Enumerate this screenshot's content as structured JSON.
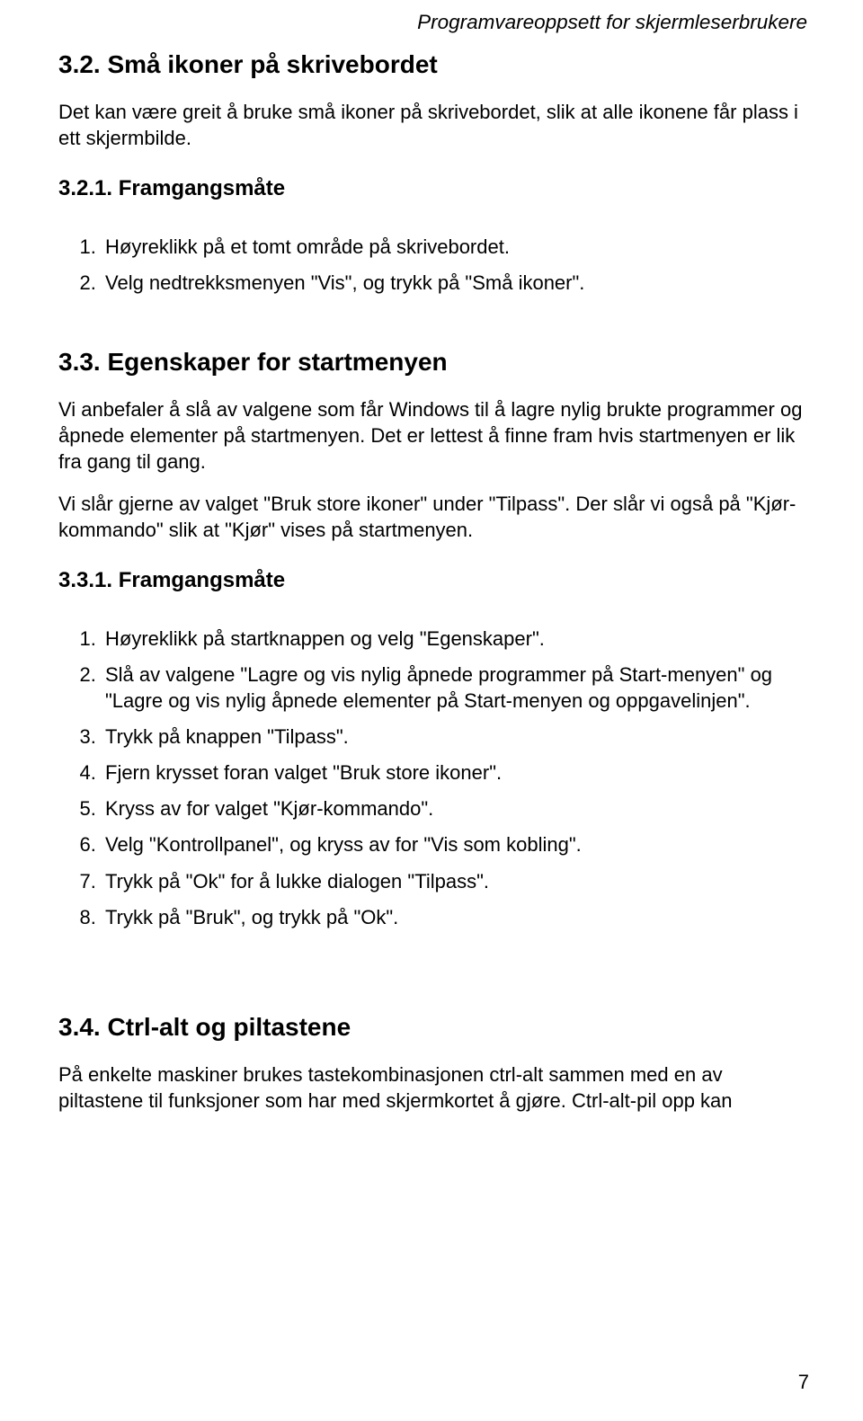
{
  "running_head": "Programvareoppsett for skjermleserbrukere",
  "sec32": {
    "title": "3.2. Små ikoner på skrivebordet",
    "p1": "Det kan være greit å bruke små ikoner på skrivebordet, slik at alle ikonene får plass i ett skjermbilde."
  },
  "sec321": {
    "title": "3.2.1. Framgangsmåte",
    "steps": [
      "Høyreklikk på et tomt område på skrivebordet.",
      "Velg nedtrekksmenyen \"Vis\", og trykk på \"Små ikoner\"."
    ]
  },
  "sec33": {
    "title": "3.3. Egenskaper for startmenyen",
    "p1": "Vi anbefaler å slå av valgene som får Windows til å lagre nylig brukte programmer og åpnede elementer på startmenyen. Det er lettest å finne fram hvis startmenyen er lik fra gang til gang.",
    "p2": "Vi slår gjerne av valget \"Bruk store ikoner\" under \"Tilpass\". Der slår vi også på \"Kjør-kommando\" slik at \"Kjør\" vises på startmenyen."
  },
  "sec331": {
    "title": "3.3.1. Framgangsmåte",
    "steps": [
      "Høyreklikk på startknappen og velg \"Egenskaper\".",
      "Slå av valgene \"Lagre og vis nylig åpnede programmer på Start-menyen\" og \"Lagre og vis nylig åpnede elementer på Start-menyen og oppgavelinjen\".",
      "Trykk på knappen \"Tilpass\".",
      "Fjern krysset foran valget \"Bruk store ikoner\".",
      "Kryss av for valget \"Kjør-kommando\".",
      "Velg \"Kontrollpanel\", og kryss av for \"Vis som kobling\".",
      "Trykk på \"Ok\" for å lukke dialogen \"Tilpass\".",
      "Trykk på \"Bruk\", og trykk på \"Ok\"."
    ]
  },
  "sec34": {
    "title": "3.4. Ctrl-alt og piltastene",
    "p1": "På enkelte maskiner brukes tastekombinasjonen ctrl-alt sammen med en av piltastene til funksjoner som har med skjermkortet å gjøre. Ctrl-alt-pil opp kan"
  },
  "page_number": "7"
}
